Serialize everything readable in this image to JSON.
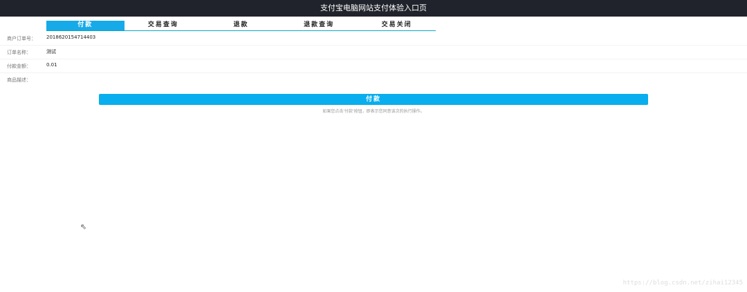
{
  "header": {
    "title": "支付宝电脑网站支付体验入口页"
  },
  "tabs": [
    {
      "label": "付款"
    },
    {
      "label": "交易查询"
    },
    {
      "label": "退款"
    },
    {
      "label": "退款查询"
    },
    {
      "label": "交易关闭"
    }
  ],
  "form": {
    "order_no": {
      "label": "商户订单号：",
      "value": "2018620154714403"
    },
    "order_name": {
      "label": "订单名称：",
      "value": "测试"
    },
    "amount": {
      "label": "付款金额：",
      "value": "0.01"
    },
    "desc": {
      "label": "商品描述：",
      "value": ""
    }
  },
  "pay_button": "付款",
  "hint": "如果您点击'付款'按钮，即表示您同意该次的执行操作。",
  "watermark": "https://blog.csdn.net/zihai12345"
}
